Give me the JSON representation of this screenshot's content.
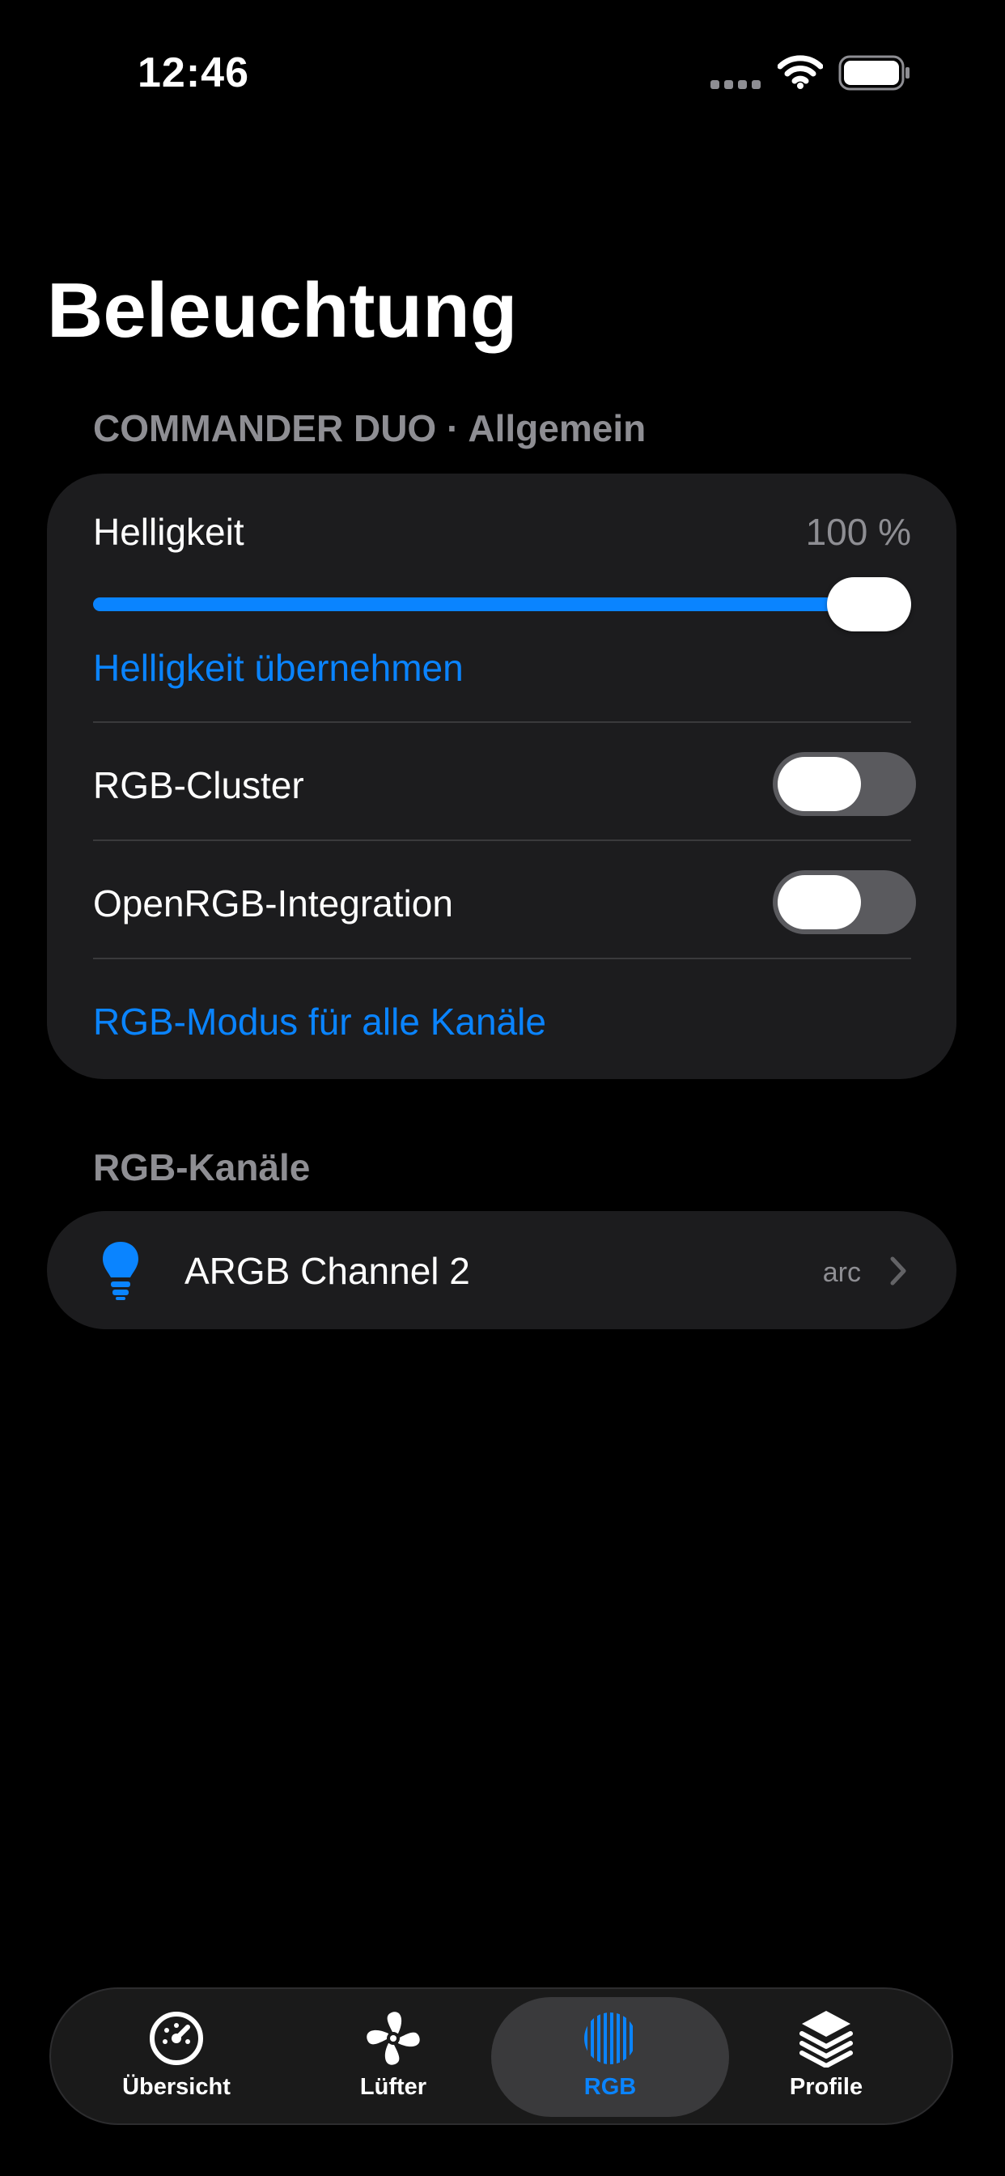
{
  "status_bar": {
    "time": "12:46"
  },
  "page": {
    "title": "Beleuchtung"
  },
  "general_section": {
    "header": "COMMANDER DUO · Allgemein",
    "brightness_label": "Helligkeit",
    "brightness_value_text": "100 %",
    "brightness_level": 1.0,
    "apply_brightness_label": "Helligkeit übernehmen",
    "rgb_cluster_label": "RGB-Cluster",
    "rgb_cluster_on": false,
    "openrgb_label": "OpenRGB-Integration",
    "openrgb_on": false,
    "rgb_mode_all_label": "RGB-Modus für alle Kanäle"
  },
  "channels_section": {
    "header": "RGB-Kanäle",
    "channels": [
      {
        "name": "ARGB Channel 2",
        "mode": "arc",
        "icon": "lightbulb-icon"
      }
    ]
  },
  "tabbar": {
    "tabs": [
      {
        "label": "Übersicht",
        "icon": "speedometer-icon",
        "active": false
      },
      {
        "label": "Lüfter",
        "icon": "fan-icon",
        "active": false
      },
      {
        "label": "RGB",
        "icon": "rgb-stripes-icon",
        "active": true
      },
      {
        "label": "Profile",
        "icon": "layers-icon",
        "active": false
      }
    ]
  },
  "colors": {
    "accent": "#0a84ff",
    "card": "#1c1c1e",
    "secondary_text": "#8e8e93"
  }
}
